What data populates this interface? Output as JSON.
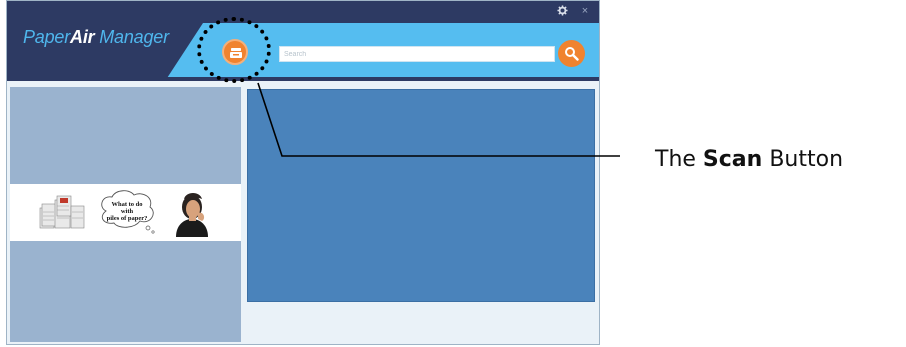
{
  "app": {
    "logo_part1": "Paper",
    "logo_part2": "Air",
    "logo_part3": " Manager"
  },
  "titlebar": {
    "settings_icon": "gear-icon",
    "close_icon": "close-icon",
    "close_glyph": "×"
  },
  "toolbar": {
    "scan_icon": "scan-icon",
    "search_placeholder": "Search",
    "search_icon": "search-icon"
  },
  "banner": {
    "bubble_line1": "What to do",
    "bubble_line2": "with",
    "bubble_line3": "piles of paper?"
  },
  "annotation": {
    "label_prefix": "The ",
    "label_bold": "Scan",
    "label_suffix": " Button"
  },
  "colors": {
    "titlebar": "#2d3a63",
    "header": "#55bdf0",
    "accent_orange": "#f0832f",
    "left_panel": "#9ab3cf",
    "right_panel": "#4a83bb"
  }
}
